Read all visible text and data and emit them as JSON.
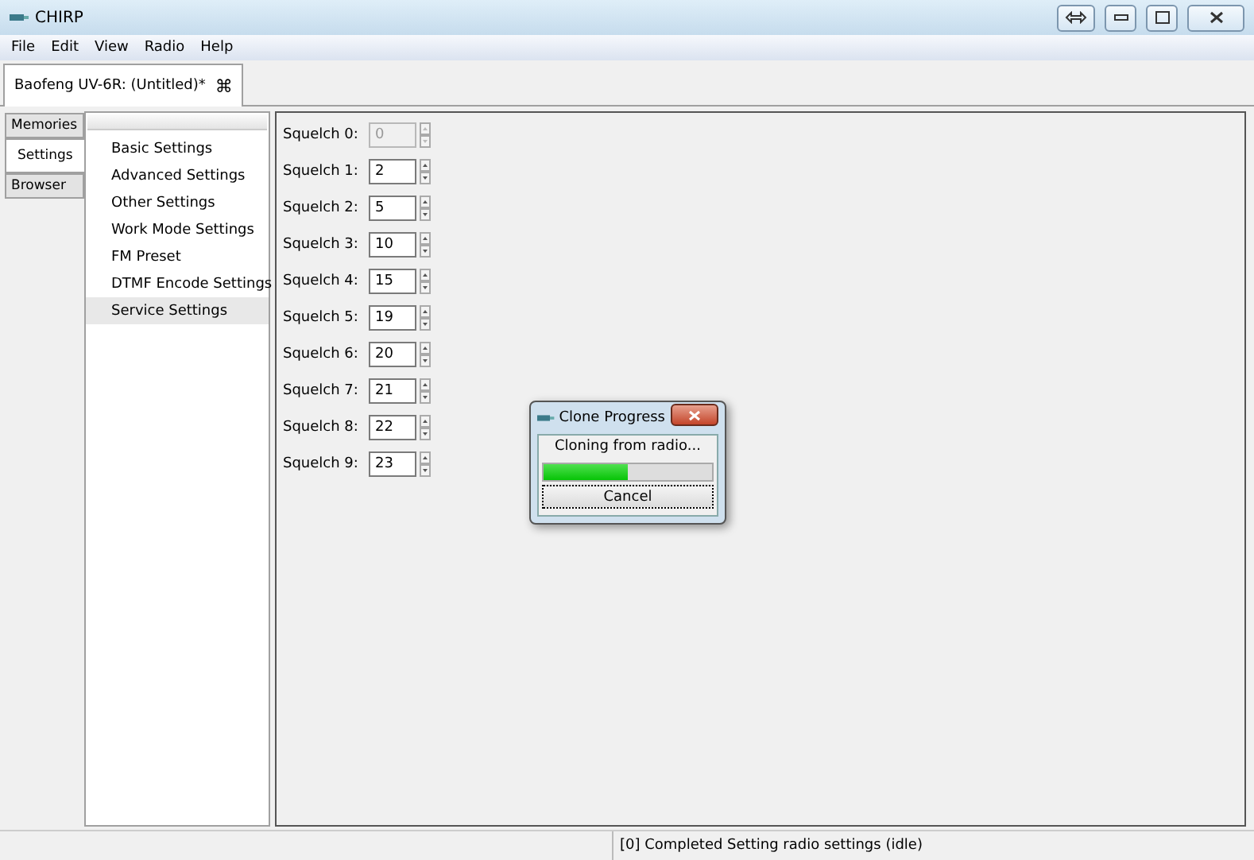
{
  "window": {
    "title": "CHIRP"
  },
  "menu": [
    "File",
    "Edit",
    "View",
    "Radio",
    "Help"
  ],
  "document_tab": {
    "label": "Baofeng UV-6R: (Untitled)*",
    "close": "⌘"
  },
  "side_tabs": [
    {
      "label": "Memories",
      "selected": false
    },
    {
      "label": "Settings",
      "selected": true
    },
    {
      "label": "Browser",
      "selected": false
    }
  ],
  "settings_tree": [
    {
      "label": "Basic Settings",
      "selected": false
    },
    {
      "label": "Advanced Settings",
      "selected": false
    },
    {
      "label": "Other Settings",
      "selected": false
    },
    {
      "label": "Work Mode Settings",
      "selected": false
    },
    {
      "label": "FM Preset",
      "selected": false
    },
    {
      "label": "DTMF Encode Settings",
      "selected": false
    },
    {
      "label": "Service Settings",
      "selected": true
    }
  ],
  "fields": [
    {
      "label": "Squelch 0:",
      "value": "0",
      "disabled": true
    },
    {
      "label": "Squelch 1:",
      "value": "2",
      "disabled": false
    },
    {
      "label": "Squelch 2:",
      "value": "5",
      "disabled": false
    },
    {
      "label": "Squelch 3:",
      "value": "10",
      "disabled": false
    },
    {
      "label": "Squelch 4:",
      "value": "15",
      "disabled": false
    },
    {
      "label": "Squelch 5:",
      "value": "19",
      "disabled": false
    },
    {
      "label": "Squelch 6:",
      "value": "20",
      "disabled": false
    },
    {
      "label": "Squelch 7:",
      "value": "21",
      "disabled": false
    },
    {
      "label": "Squelch 8:",
      "value": "22",
      "disabled": false
    },
    {
      "label": "Squelch 9:",
      "value": "23",
      "disabled": false
    }
  ],
  "dialog": {
    "title": "Clone Progress",
    "message": "Cloning from radio...",
    "level": 0.5,
    "button": "Cancel"
  },
  "status_bar": {
    "message": "[0] Completed Setting radio settings (idle)"
  }
}
